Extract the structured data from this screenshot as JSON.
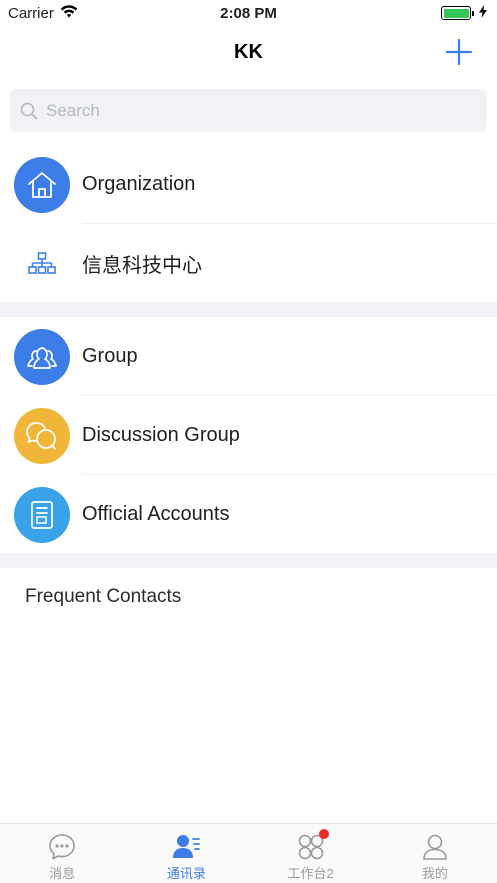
{
  "status_bar": {
    "carrier": "Carrier",
    "time": "2:08 PM",
    "icons": [
      "wifi-icon",
      "battery-icon",
      "charging-bolt-icon"
    ]
  },
  "nav": {
    "title": "KK",
    "add_icon": "plus-icon",
    "accent": "#3d7de8"
  },
  "search": {
    "placeholder": "Search",
    "value": "",
    "icon": "search-icon"
  },
  "section1": {
    "items": [
      {
        "label": "Organization",
        "icon": "house-icon",
        "color": "#3d7de8"
      },
      {
        "label": "信息科技中心",
        "icon": "org-tree-icon",
        "color": "#3d7de8"
      }
    ]
  },
  "section2": {
    "items": [
      {
        "label": "Group",
        "icon": "group-people-icon",
        "color": "#3d7de8"
      },
      {
        "label": "Discussion Group",
        "icon": "chat-bubbles-icon",
        "color": "#f0b63a"
      },
      {
        "label": "Official Accounts",
        "icon": "document-icon",
        "color": "#3aa3e8"
      }
    ]
  },
  "frequent_contacts": {
    "label": "Frequent Contacts"
  },
  "tab_bar": {
    "tabs": [
      {
        "label": "消息",
        "icon": "chat-dots-icon",
        "active": false
      },
      {
        "label": "通讯录",
        "icon": "contacts-icon",
        "active": true
      },
      {
        "label": "工作台2",
        "icon": "workbench-icon",
        "active": false,
        "badge": true
      },
      {
        "label": "我的",
        "icon": "profile-icon",
        "active": false
      }
    ],
    "active_color": "#3d7de8",
    "inactive_color": "#9a9a9a",
    "badge_color": "#ee2b2b"
  }
}
